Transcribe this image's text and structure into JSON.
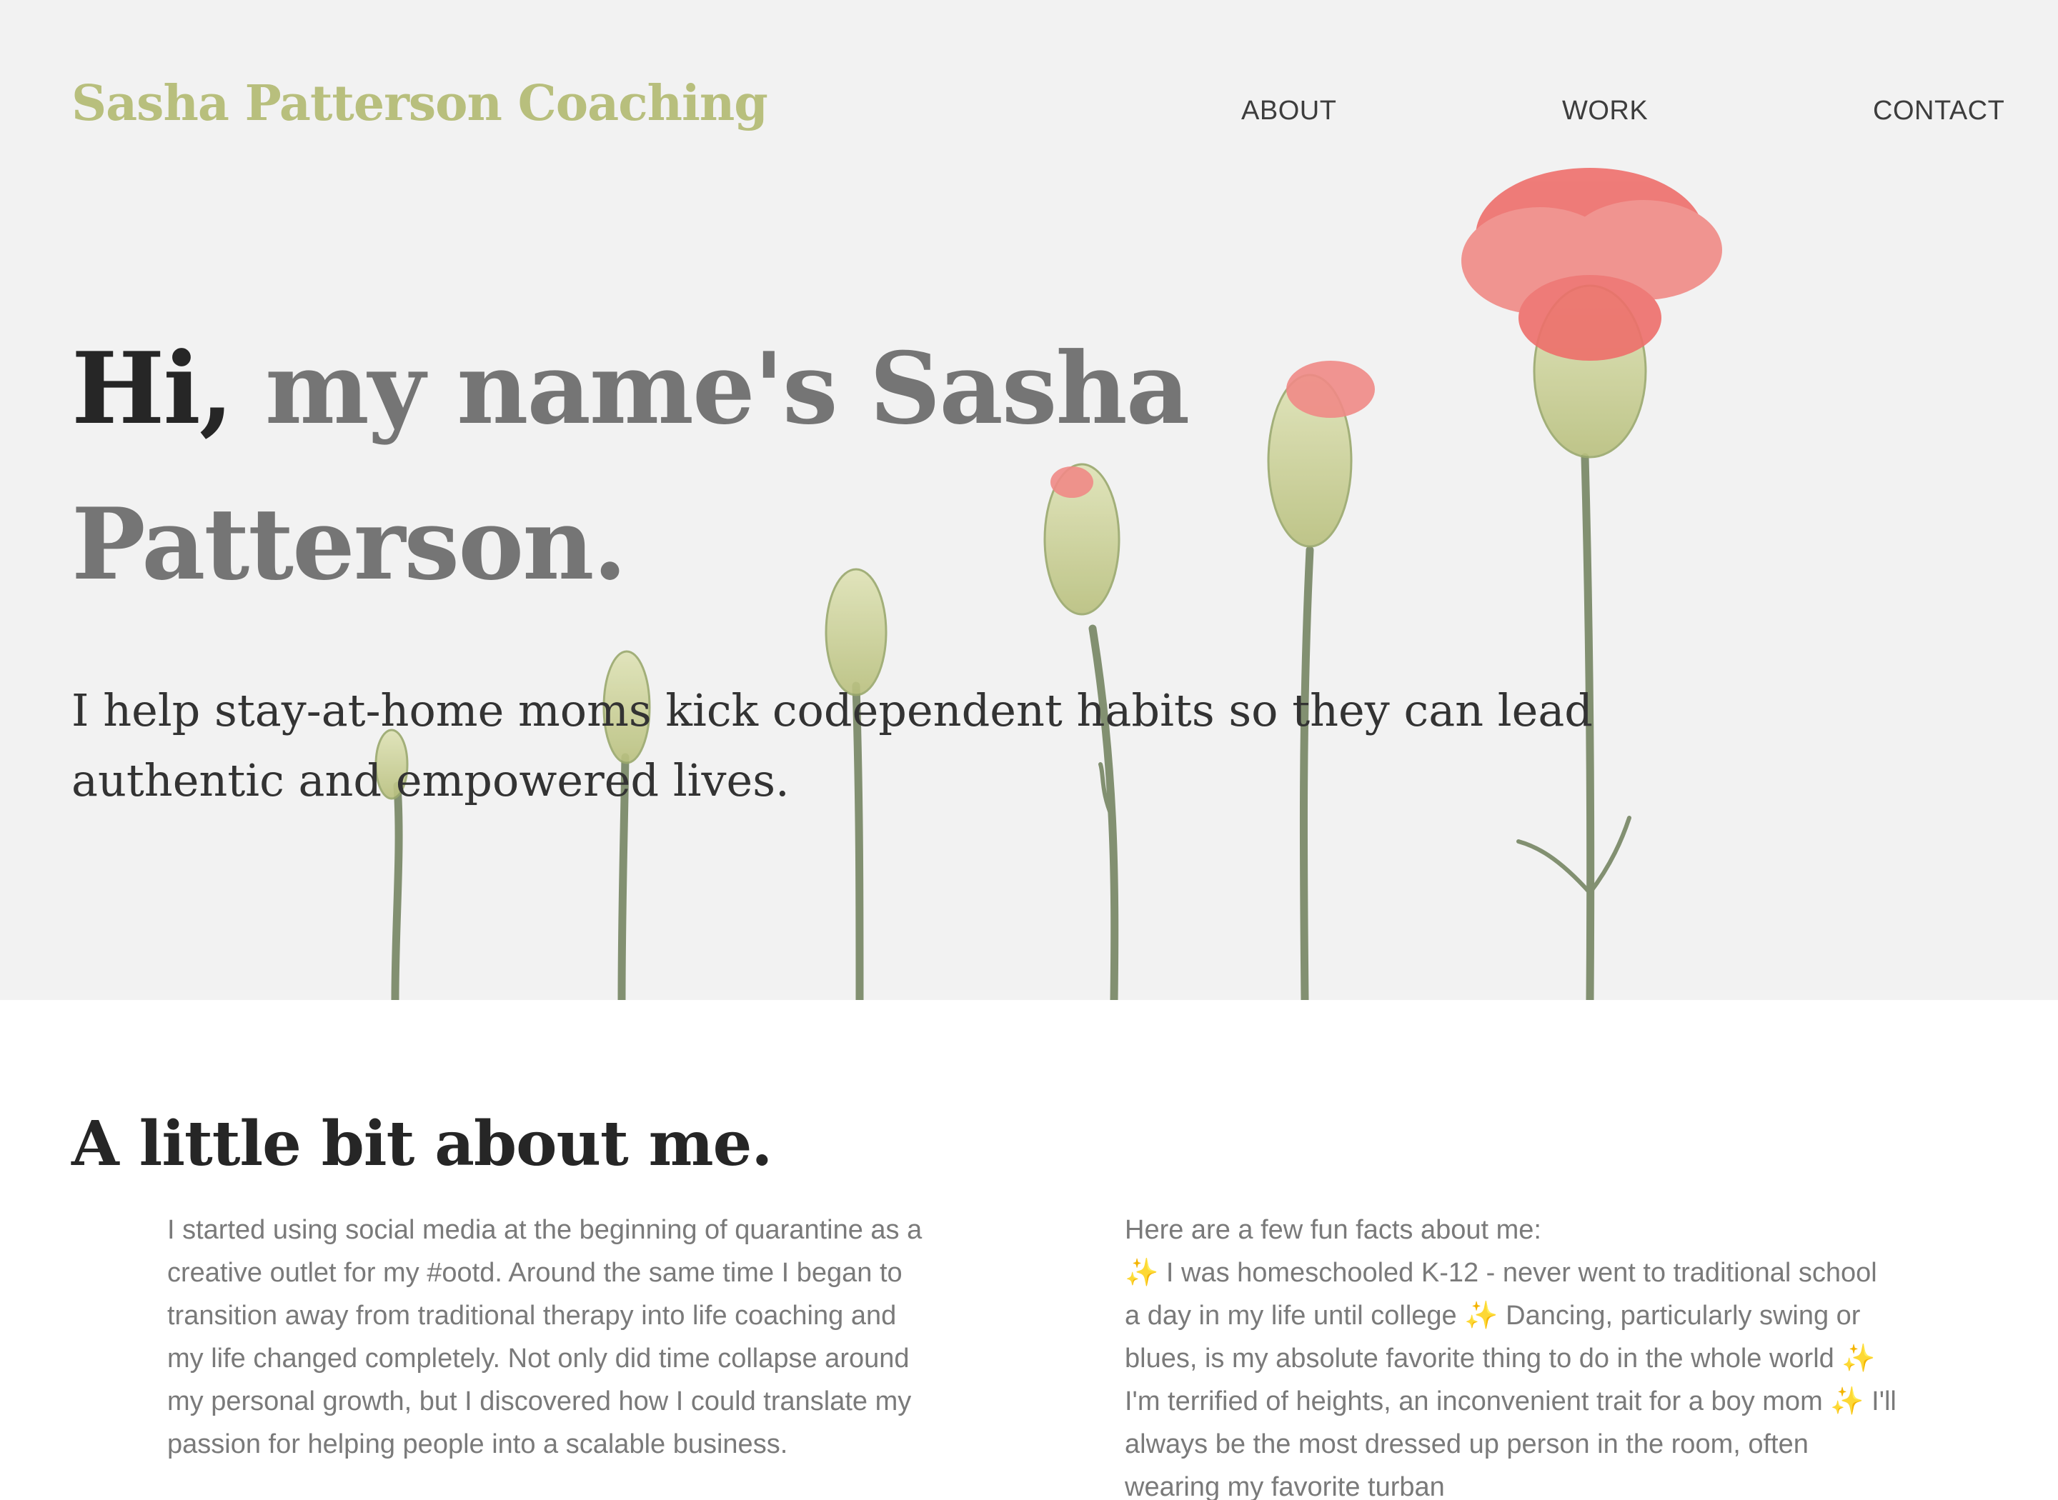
{
  "header": {
    "brand": "Sasha Patterson Coaching",
    "nav": {
      "about": "ABOUT",
      "work": "WORK",
      "contact": "CONTACT"
    }
  },
  "hero": {
    "greeting": "Hi,",
    "heading_rest": " my name's Sasha Patterson.",
    "subtitle": "I help stay-at-home moms kick codependent habits so they can lead authentic and empowered lives.",
    "image": "carnation-flowers-image"
  },
  "about": {
    "title": "A little bit about me.",
    "left_paragraph": "I started using social media at the beginning of quarantine as a creative outlet for my #ootd. Around the same time I began to transition away from traditional therapy into life coaching and my life changed completely. Not only did time collapse around my personal growth, but I discovered how I could translate my passion for helping people into a scalable business.",
    "fun_facts_intro": "Here are a few fun facts about me:",
    "sparkle_icon": "✨",
    "facts": [
      " I was homeschooled K-12 - never went to traditional school a day in my life until college ",
      " Dancing, particularly swing or blues, is my absolute favorite thing to do in the whole world ",
      " I'm terrified of heights, an inconvenient trait for a boy mom ",
      " I'll always be the most dressed up person in the room, often wearing my favorite turban"
    ]
  },
  "colors": {
    "brand": "#b8bf7d",
    "hero_bg": "#f2f2f2",
    "heading_dark": "#262626",
    "heading_muted": "#757575",
    "body_text": "#7a7a7a",
    "sparkle": "#f1c21b"
  }
}
